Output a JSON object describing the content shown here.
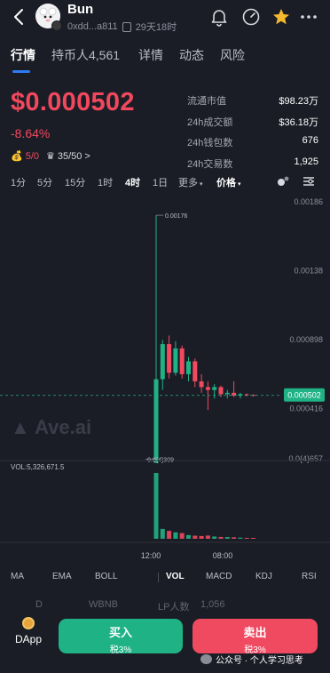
{
  "header": {
    "token_name": "Bun",
    "address": "0xdd...a811",
    "age": "29天18时"
  },
  "tabs": [
    {
      "label": "行情",
      "active": true
    },
    {
      "label": "持币人4,561",
      "active": false
    },
    {
      "label": "详情",
      "active": false
    },
    {
      "label": "动态",
      "active": false
    },
    {
      "label": "风险",
      "active": false
    }
  ],
  "price": {
    "value": "$0.000502",
    "change": "-8.64%",
    "color": "#f2485d"
  },
  "chips": {
    "bag": "5/0",
    "crown": "35/50",
    "arrow": ">"
  },
  "stats": [
    {
      "label": "流通市值",
      "value": "$98.23万"
    },
    {
      "label": "24h成交额",
      "value": "$36.18万"
    },
    {
      "label": "24h钱包数",
      "value": "676"
    },
    {
      "label": "24h交易数",
      "value": "1,925"
    }
  ],
  "intervals": [
    {
      "label": "1分",
      "active": false
    },
    {
      "label": "5分",
      "active": false
    },
    {
      "label": "15分",
      "active": false
    },
    {
      "label": "1时",
      "active": false
    },
    {
      "label": "4时",
      "active": true
    },
    {
      "label": "1日",
      "active": false
    },
    {
      "label": "更多",
      "active": false
    }
  ],
  "price_selector": "价格",
  "chart_data": {
    "type": "candlestick",
    "y_axis_labels": [
      "0.00186",
      "0.00138",
      "0.000898",
      "0.000416",
      "0.0{4}657"
    ],
    "last_price": "0.000502",
    "max_label": "0.00176",
    "min_label": "0.0{4}309",
    "x_axis_labels": [
      "12:00",
      "08:00"
    ],
    "volume_label": "VOL:5,326,671.5",
    "watermark": "Ave.ai",
    "candles": [
      {
        "o": 3.09e-05,
        "h": 0.00176,
        "l": 3.09e-05,
        "c": 0.000615
      },
      {
        "o": 0.000615,
        "h": 0.00089,
        "l": 0.00054,
        "c": 0.00086
      },
      {
        "o": 0.00086,
        "h": 0.00092,
        "l": 0.00062,
        "c": 0.00066
      },
      {
        "o": 0.00066,
        "h": 0.00088,
        "l": 0.00064,
        "c": 0.00083
      },
      {
        "o": 0.00083,
        "h": 0.00085,
        "l": 0.00062,
        "c": 0.00065
      },
      {
        "o": 0.00065,
        "h": 0.00077,
        "l": 0.0006,
        "c": 0.00074
      },
      {
        "o": 0.00074,
        "h": 0.00076,
        "l": 0.00056,
        "c": 0.0006
      },
      {
        "o": 0.0006,
        "h": 0.00065,
        "l": 0.00052,
        "c": 0.00056
      },
      {
        "o": 0.00056,
        "h": 0.0006,
        "l": 0.0004,
        "c": 0.00054
      },
      {
        "o": 0.00054,
        "h": 0.00058,
        "l": 0.00048,
        "c": 0.00056
      },
      {
        "o": 0.00056,
        "h": 0.00057,
        "l": 0.00049,
        "c": 0.00051
      },
      {
        "o": 0.00051,
        "h": 0.00054,
        "l": 0.00048,
        "c": 0.00052
      },
      {
        "o": 0.00052,
        "h": 0.0006,
        "l": 0.00049,
        "c": 0.0005
      },
      {
        "o": 0.0005,
        "h": 0.00052,
        "l": 0.00048,
        "c": 0.00051
      },
      {
        "o": 0.00051,
        "h": 0.000515,
        "l": 0.000495,
        "c": 0.000505
      },
      {
        "o": 0.000505,
        "h": 0.00051,
        "l": 0.000495,
        "c": 0.000502
      }
    ],
    "volumes": [
      5326671.5,
      800000,
      640000,
      520000,
      460000,
      300000,
      250000,
      220000,
      260000,
      180000,
      150000,
      140000,
      120000,
      90000,
      60000,
      40000
    ],
    "up_color": "#1fb285",
    "down_color": "#f04a61"
  },
  "indicators": [
    {
      "label": "MA",
      "active": false
    },
    {
      "label": "EMA",
      "active": false
    },
    {
      "label": "BOLL",
      "active": false
    },
    {
      "label": "VOL",
      "active": true
    },
    {
      "label": "MACD",
      "active": false
    },
    {
      "label": "KDJ",
      "active": false
    },
    {
      "label": "RSI",
      "active": false
    }
  ],
  "ghost_row": {
    "left": "D",
    "mid": "WBNB",
    "right_label": "LP人数",
    "right_value": "1,056"
  },
  "bottom": {
    "dapp_label": "DApp",
    "buy_label": "买入",
    "buy_tax": "税3%",
    "sell_label": "卖出",
    "sell_tax": "税3%"
  },
  "watermark": "公众号 · 个人学习思考"
}
